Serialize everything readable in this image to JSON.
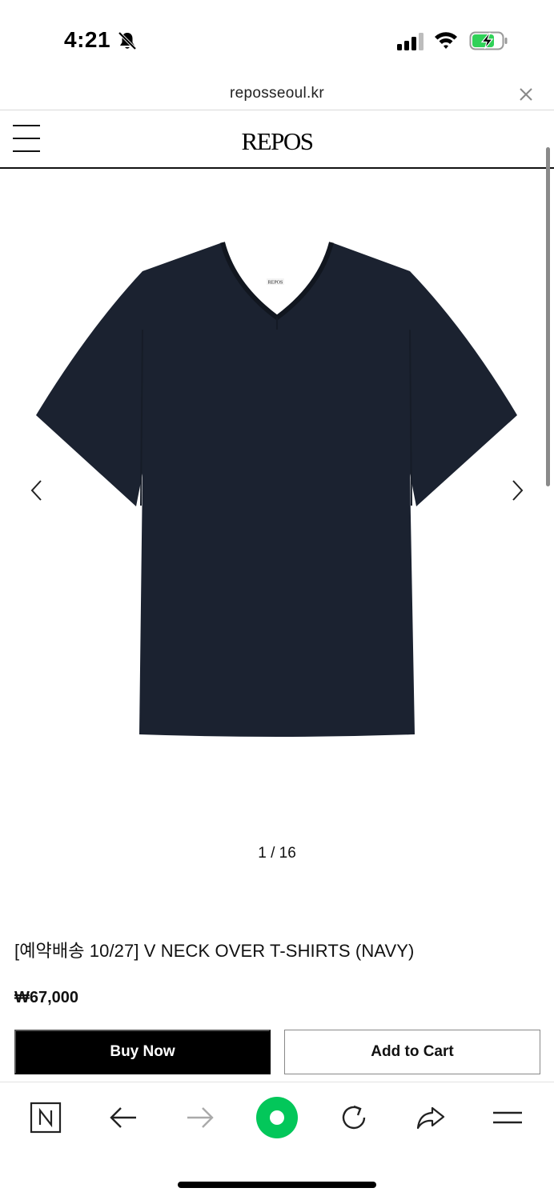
{
  "status_bar": {
    "time": "4:21",
    "icons": [
      "bell-slash-icon",
      "cellular-signal-icon",
      "wifi-icon",
      "battery-charging-icon"
    ],
    "battery_color": "#30d158"
  },
  "browser": {
    "url": "reposseoul.kr",
    "close_icon": "close-icon"
  },
  "site_header": {
    "menu_icon": "hamburger-menu-icon",
    "logo": "REPOS"
  },
  "product": {
    "image": {
      "description_icon": "tshirt-image",
      "color": "#1b2230",
      "label_text": "REPOS",
      "prev_icon": "chevron-left-icon",
      "next_icon": "chevron-right-icon"
    },
    "pager": "1 / 16",
    "title": "[예약배송 10/27] V NECK OVER T-SHIRTS (NAVY)",
    "price": "₩67,000",
    "buy_now_label": "Buy Now",
    "add_to_cart_label": "Add to Cart"
  },
  "bottom_toolbar": {
    "items": [
      "naver-home-icon",
      "back-arrow-icon",
      "forward-arrow-icon",
      "green-circle-icon",
      "reload-icon",
      "share-icon",
      "menu-icon"
    ],
    "accent_color": "#03c75a"
  }
}
